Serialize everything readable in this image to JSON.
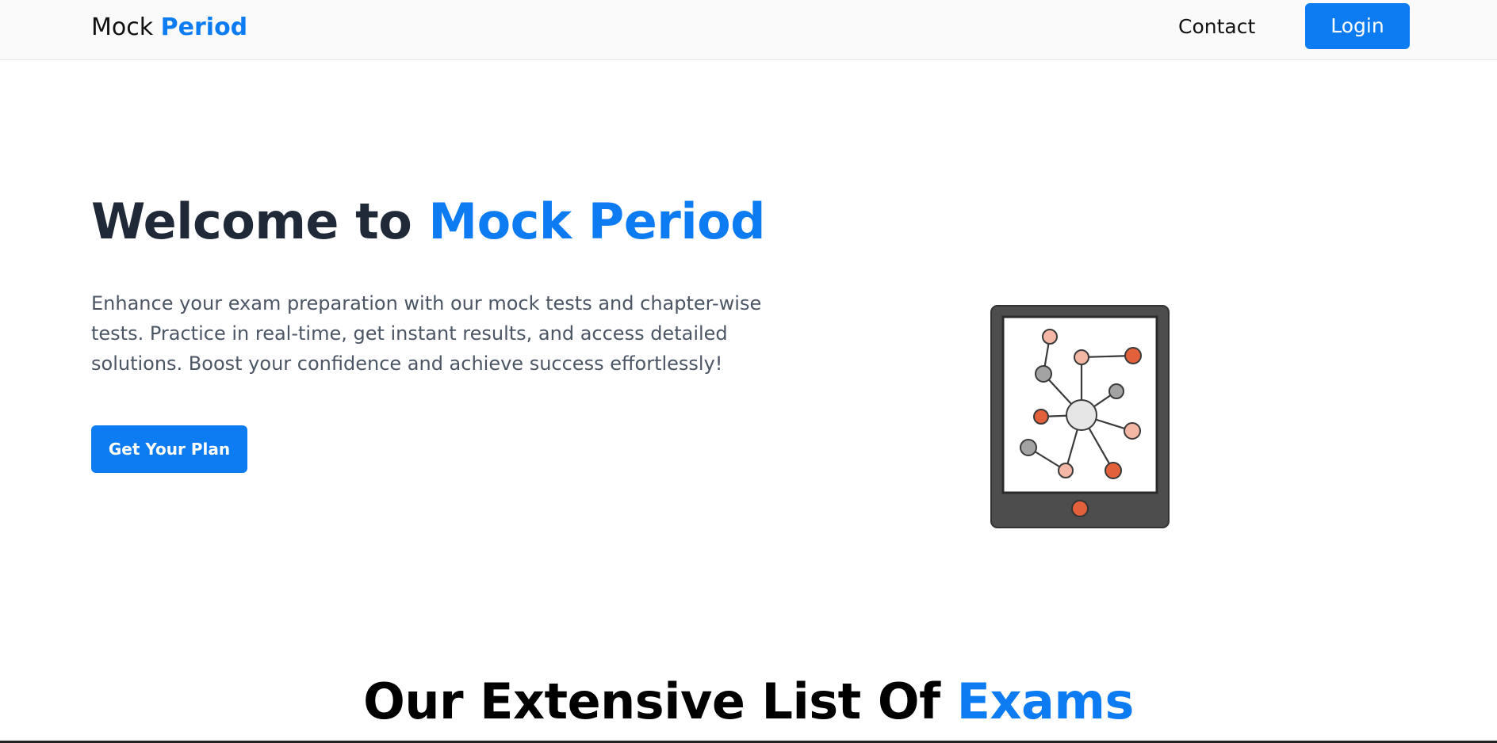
{
  "brand": {
    "prefix": "Mock",
    "highlight": "Period"
  },
  "nav": {
    "contact_label": "Contact",
    "login_label": "Login"
  },
  "hero": {
    "title_prefix": "Welcome to",
    "title_highlight": "Mock Period",
    "description": "Enhance your exam preparation with our mock tests and chapter-wise tests. Practice in real-time, get instant results, and access detailed solutions. Boost your confidence and achieve success effortlessly!",
    "cta_label": "Get Your Plan",
    "illustration_icon": "tablet-network-icon"
  },
  "exams_section": {
    "title_prefix": "Our Extensive List Of",
    "title_highlight": "Exams"
  },
  "colors": {
    "accent": "#0d7bf2",
    "heading": "#1f2937",
    "body_text": "#4b5563",
    "node_orange": "#e2603a",
    "node_pink": "#f4b7a5",
    "node_gray": "#a3a3a3",
    "tablet_frame": "#4d4d4d"
  }
}
